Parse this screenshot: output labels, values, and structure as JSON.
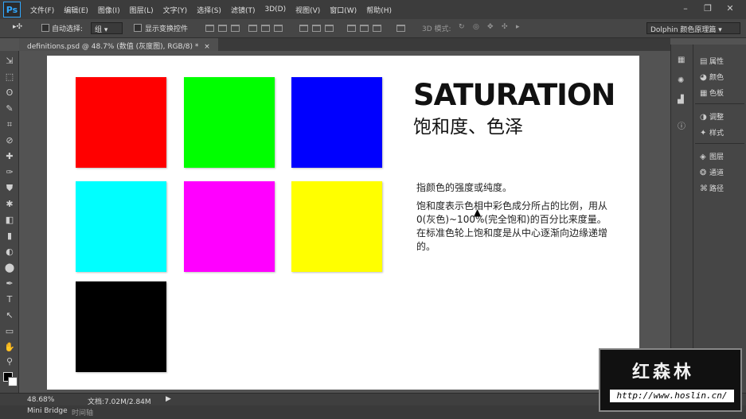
{
  "app": {
    "logo": "Ps"
  },
  "menubar": {
    "items": [
      "文件(F)",
      "编辑(E)",
      "图像(I)",
      "图层(L)",
      "文字(Y)",
      "选择(S)",
      "滤镜(T)",
      "3D(D)",
      "视图(V)",
      "窗口(W)",
      "帮助(H)"
    ]
  },
  "window_controls": {
    "minimize": "–",
    "restore": "❐",
    "close": "✕"
  },
  "options": {
    "tool_glyph": "▸✣",
    "auto_select_label": "自动选择:",
    "auto_select_value": "组",
    "show_transform_label": "显示变换控件",
    "mode3d_label": "3D 模式:",
    "workspace": "Dolphin 颜色原理篇"
  },
  "document": {
    "tab_title": "definitions.psd @ 48.7% (数值 (灰度图), RGB/8) *",
    "close": "×"
  },
  "tools": [
    "⇲",
    "⬚",
    "ʘ",
    "✎",
    "⌗",
    "⊘",
    "✚",
    "✑",
    "⛊",
    "✱",
    "◧",
    "▮",
    "◐",
    "⬤",
    "✒",
    "T",
    "↖",
    "▭",
    "✋",
    "⚲"
  ],
  "artboard": {
    "title": "SATURATION",
    "subtitle": "饱和度、色泽",
    "desc1": "指颜色的强度或纯度。",
    "desc2": "饱和度表示色相中彩色成分所占的比例，用从0(灰色)~100%(完全饱和)的百分比来度量。在标准色轮上饱和度是从中心逐渐向边缘递增的。"
  },
  "swatches": [
    "#ff0000",
    "#00ff00",
    "#0000ff",
    "#00ffff",
    "#ff00ff",
    "#ffff00",
    "#000000"
  ],
  "panels": {
    "group1": [
      "属性",
      "颜色",
      "色板"
    ],
    "group2": [
      "调整",
      "样式"
    ],
    "group3": [
      "图层",
      "通道",
      "路径"
    ]
  },
  "status": {
    "zoom": "48.68%",
    "doc_info": "文档:7.02M/2.84M"
  },
  "bottom_tabs": {
    "bridge": "Mini Bridge",
    "timeline": "时间轴"
  },
  "watermark": {
    "title": "红森林",
    "url": "http://www.hoslin.cn/"
  }
}
